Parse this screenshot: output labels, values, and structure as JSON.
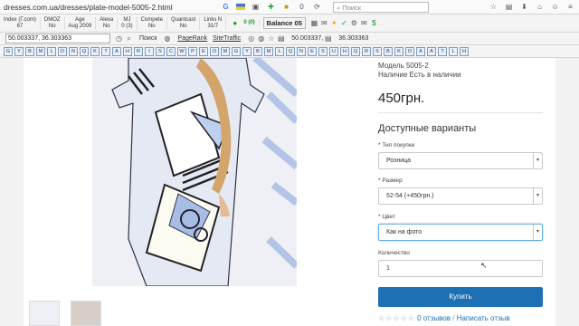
{
  "browser": {
    "url": "dresses.com.ua/dresses/plate-model-5005-2.html",
    "search_placeholder": "Поиск"
  },
  "seo_bar": {
    "cells": [
      {
        "line1": "Index (Г.com)",
        "line2": "67"
      },
      {
        "line1": "DMOZ",
        "line2": "No"
      },
      {
        "line1": "Age",
        "line2": "Aug 2009"
      },
      {
        "line1": "Alexa",
        "line2": "No"
      },
      {
        "line1": "MJ",
        "line2": "0 (3)"
      },
      {
        "line1": "Compete",
        "line2": "No"
      },
      {
        "line1": "Quantcast",
        "line2": "No"
      },
      {
        "line1": "Links N",
        "line2": "31/7"
      }
    ],
    "green_counter": "0 (0)",
    "balance": "Balance 05",
    "zero": "0"
  },
  "toolbar2": {
    "coords_select": "50.003337, 36.303363",
    "search": "Поиск",
    "pagerank": "PageRank",
    "sitetraffic": "SiteTraffic",
    "coords_a": "50.003337,",
    "coords_b": "36.303363"
  },
  "toolbar3": {
    "buttons": [
      "G",
      "Y",
      "B",
      "M",
      "L",
      "D",
      "N",
      "Q",
      "K",
      "T",
      "A",
      "H",
      "R",
      "I",
      "S",
      "C",
      "W",
      "P",
      "E",
      "O",
      "M",
      "G",
      "Y",
      "B",
      "M",
      "L",
      "Q",
      "N",
      "E",
      "S",
      "U",
      "H",
      "Q",
      "R",
      "S",
      "B",
      "K",
      "O",
      "A",
      "A",
      "T",
      "L",
      "H"
    ]
  },
  "product": {
    "model": "Модель 5005-2",
    "availability": "Наличие Есть в наличии",
    "price": "450грн.",
    "variants_title": "Доступные варианты",
    "purchase_type_label": "Тип покупки",
    "purchase_type_value": "Розница",
    "size_label": "Размер",
    "size_value": "52-54 (+450грн.)",
    "color_label": "Цвет",
    "color_value": "Как на фото",
    "quantity_label": "Количество",
    "quantity_value": "1",
    "buy_label": "Купить",
    "reviews_stars": "☆☆☆☆☆",
    "reviews_count": "0 отзывов",
    "write_review": "Написать отзыв"
  }
}
